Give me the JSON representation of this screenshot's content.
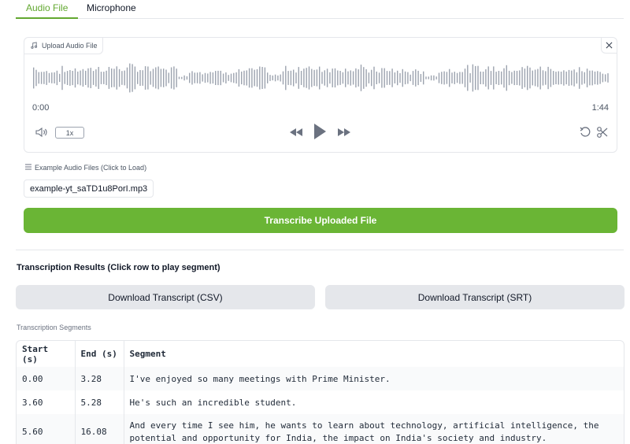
{
  "tabs": [
    {
      "label": "Audio File",
      "active": true
    },
    {
      "label": "Microphone",
      "active": false
    }
  ],
  "audio_player": {
    "upload_label": "Upload Audio File",
    "current_time": "0:00",
    "duration": "1:44",
    "playback_speed": "1x",
    "icons": [
      "music-note-icon",
      "close-icon",
      "volume-icon",
      "rewind-icon",
      "play-icon",
      "fast-forward-icon",
      "reset-icon",
      "trim-icon"
    ]
  },
  "examples": {
    "label": "Example Audio Files (Click to Load)",
    "files": [
      "example-yt_saTD1u8PorI.mp3"
    ]
  },
  "transcribe_button": "Transcribe Uploaded File",
  "results": {
    "title": "Transcription Results (Click row to play segment)",
    "download_csv": "Download Transcript (CSV)",
    "download_srt": "Download Transcript (SRT)",
    "segments_label": "Transcription Segments"
  },
  "table": {
    "headers": [
      "Start (s)",
      "End (s)",
      "Segment"
    ],
    "rows": [
      {
        "start": "0.00",
        "end": "3.28",
        "segment": "I've enjoyed so many meetings with Prime Minister."
      },
      {
        "start": "3.60",
        "end": "5.28",
        "segment": "He's such an incredible student."
      },
      {
        "start": "5.60",
        "end": "16.08",
        "segment_line1": "And every time I see him, he wants to learn about technology, artificial intelligence, the",
        "segment_line2": "potential and opportunity for India, the impact on India's society and industry."
      }
    ]
  },
  "colors": {
    "accent": "#6ab535",
    "tab_active": "#62a830",
    "button_gray": "#e5e7eb",
    "waveform": "#9ca3af"
  }
}
